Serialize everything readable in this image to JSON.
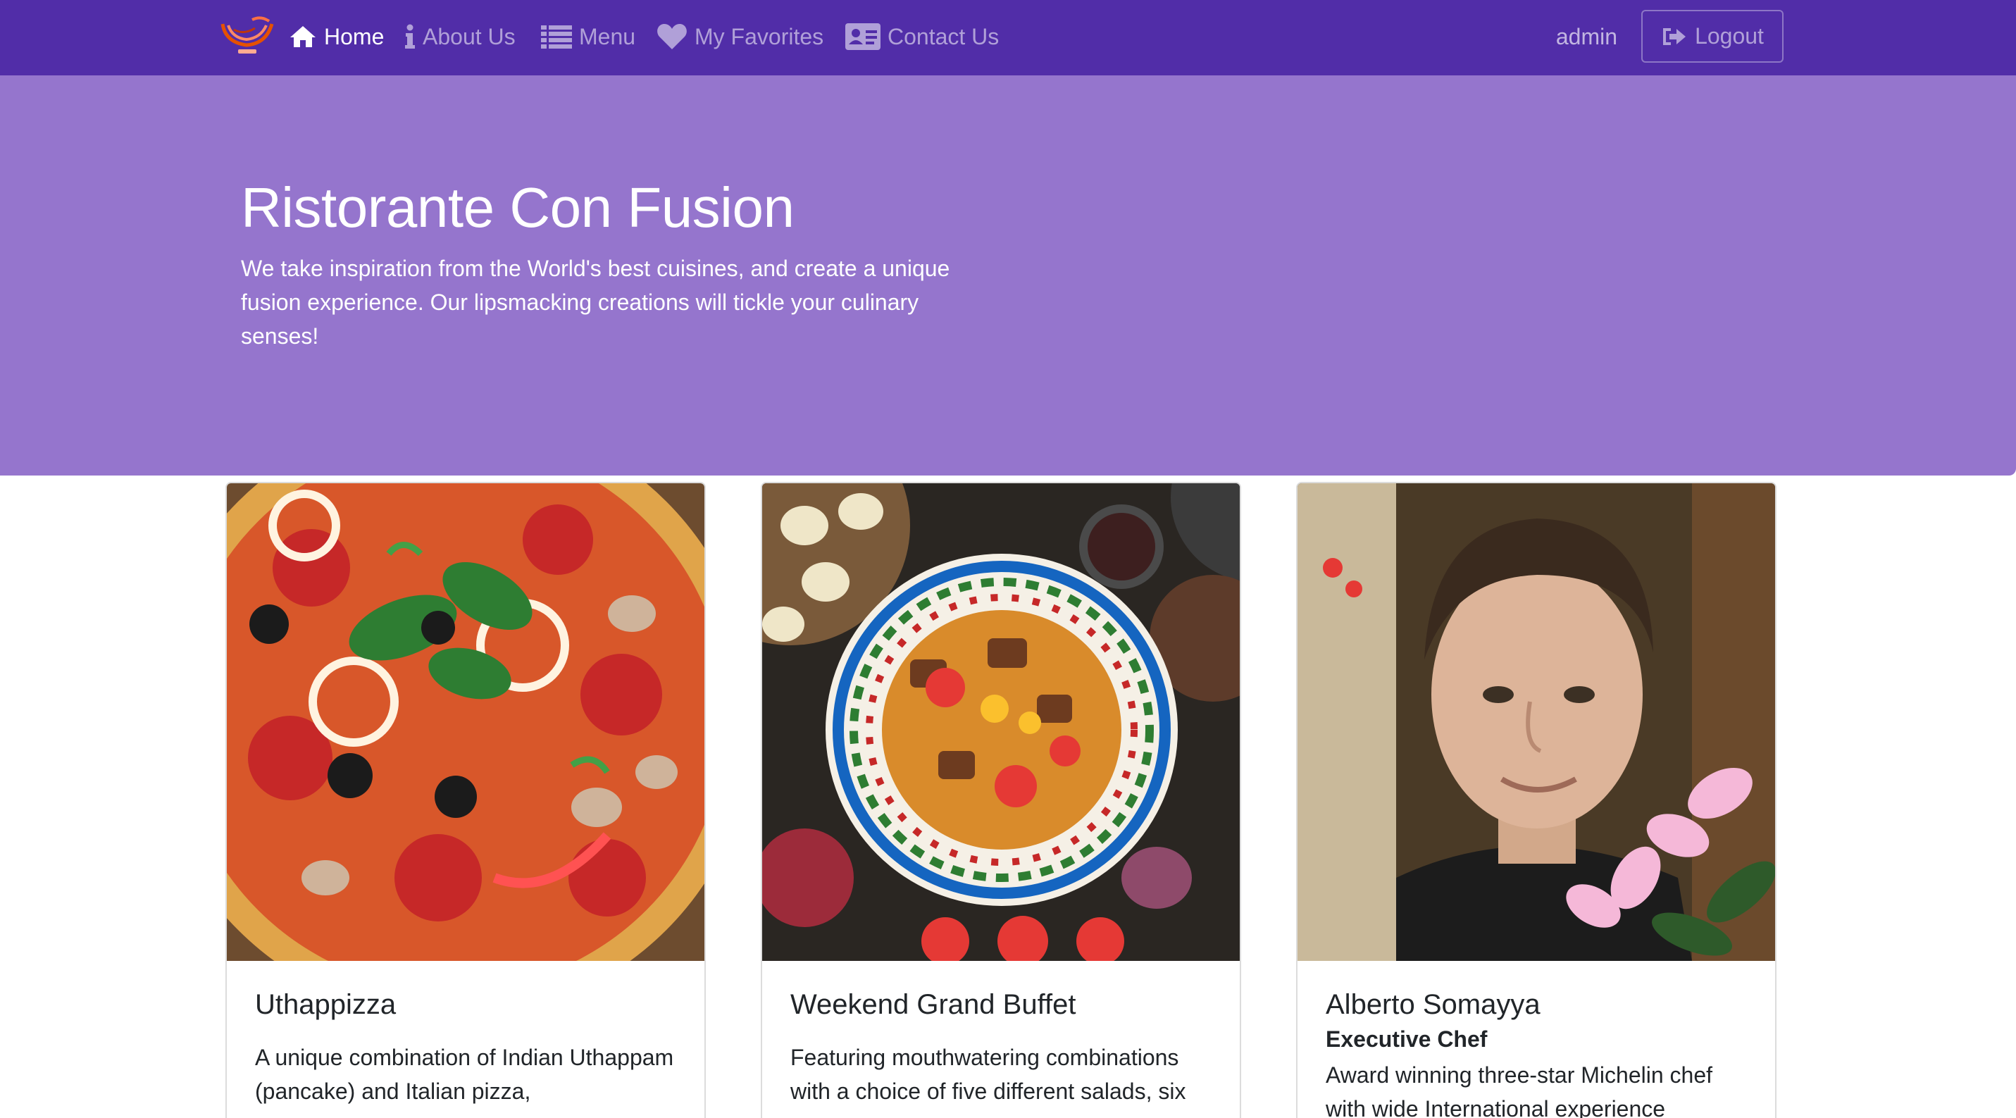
{
  "navbar": {
    "items": [
      {
        "label": "Home",
        "icon": "home-icon",
        "active": true
      },
      {
        "label": "About Us",
        "icon": "info-icon",
        "active": false
      },
      {
        "label": "Menu",
        "icon": "list-icon",
        "active": false
      },
      {
        "label": "My Favorites",
        "icon": "heart-icon",
        "active": false
      },
      {
        "label": "Contact Us",
        "icon": "address-card-icon",
        "active": false
      }
    ],
    "username": "admin",
    "logout_label": "Logout",
    "background": "#512da8"
  },
  "jumbotron": {
    "title": "Ristorante Con Fusion",
    "text": "We take inspiration from the World's best cuisines, and create a unique fusion experience. Our lipsmacking creations will tickle your culinary senses!",
    "background": "#9575cd"
  },
  "cards": [
    {
      "title": "Uthappizza",
      "subtitle": "",
      "text": "A unique combination of Indian Uthappam (pancake) and Italian pizza,",
      "image": "pizza-photo"
    },
    {
      "title": "Weekend Grand Buffet",
      "subtitle": "",
      "text": "Featuring mouthwatering combinations with a choice of five different salads, six",
      "image": "buffet-photo"
    },
    {
      "title": "Alberto Somayya",
      "subtitle": "Executive Chef",
      "text": "Award winning three-star Michelin chef with wide International experience",
      "image": "chef-portrait-photo"
    }
  ]
}
